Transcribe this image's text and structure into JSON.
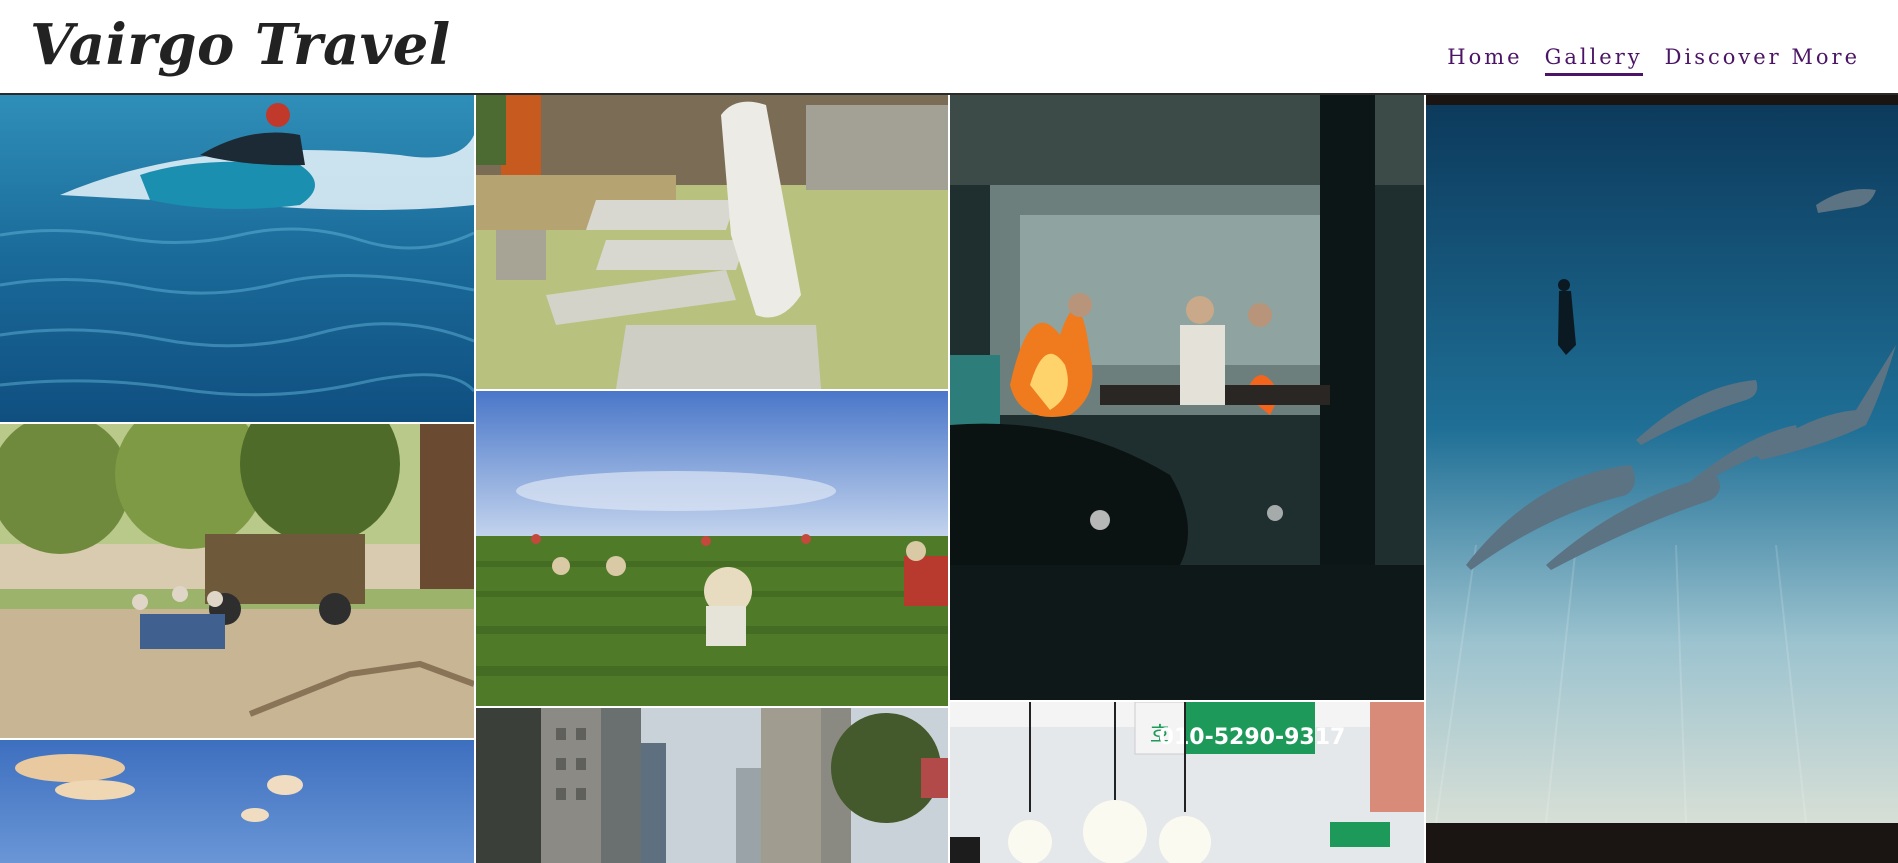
{
  "site": {
    "title": "Vairgo Travel"
  },
  "nav": {
    "items": [
      {
        "label": "Home",
        "active": false
      },
      {
        "label": "Gallery",
        "active": true
      },
      {
        "label": "Discover More",
        "active": false
      }
    ]
  },
  "gallery": {
    "photos": [
      {
        "name": "jet-ski-ocean-photo"
      },
      {
        "name": "white-robed-figure-steps-photo"
      },
      {
        "name": "night-street-food-grill-photo"
      },
      {
        "name": "dolphins-freediver-photo"
      },
      {
        "name": "safari-picnic-photo"
      },
      {
        "name": "tea-field-pickers-photo"
      },
      {
        "name": "sky-clouds-photo"
      },
      {
        "name": "city-skyscrapers-photo"
      },
      {
        "name": "market-lamps-sign-photo",
        "sign_text": "010-5290-9317",
        "sign_small": "호"
      }
    ]
  },
  "colors": {
    "nav": "#4b1466",
    "logo": "#222222"
  }
}
